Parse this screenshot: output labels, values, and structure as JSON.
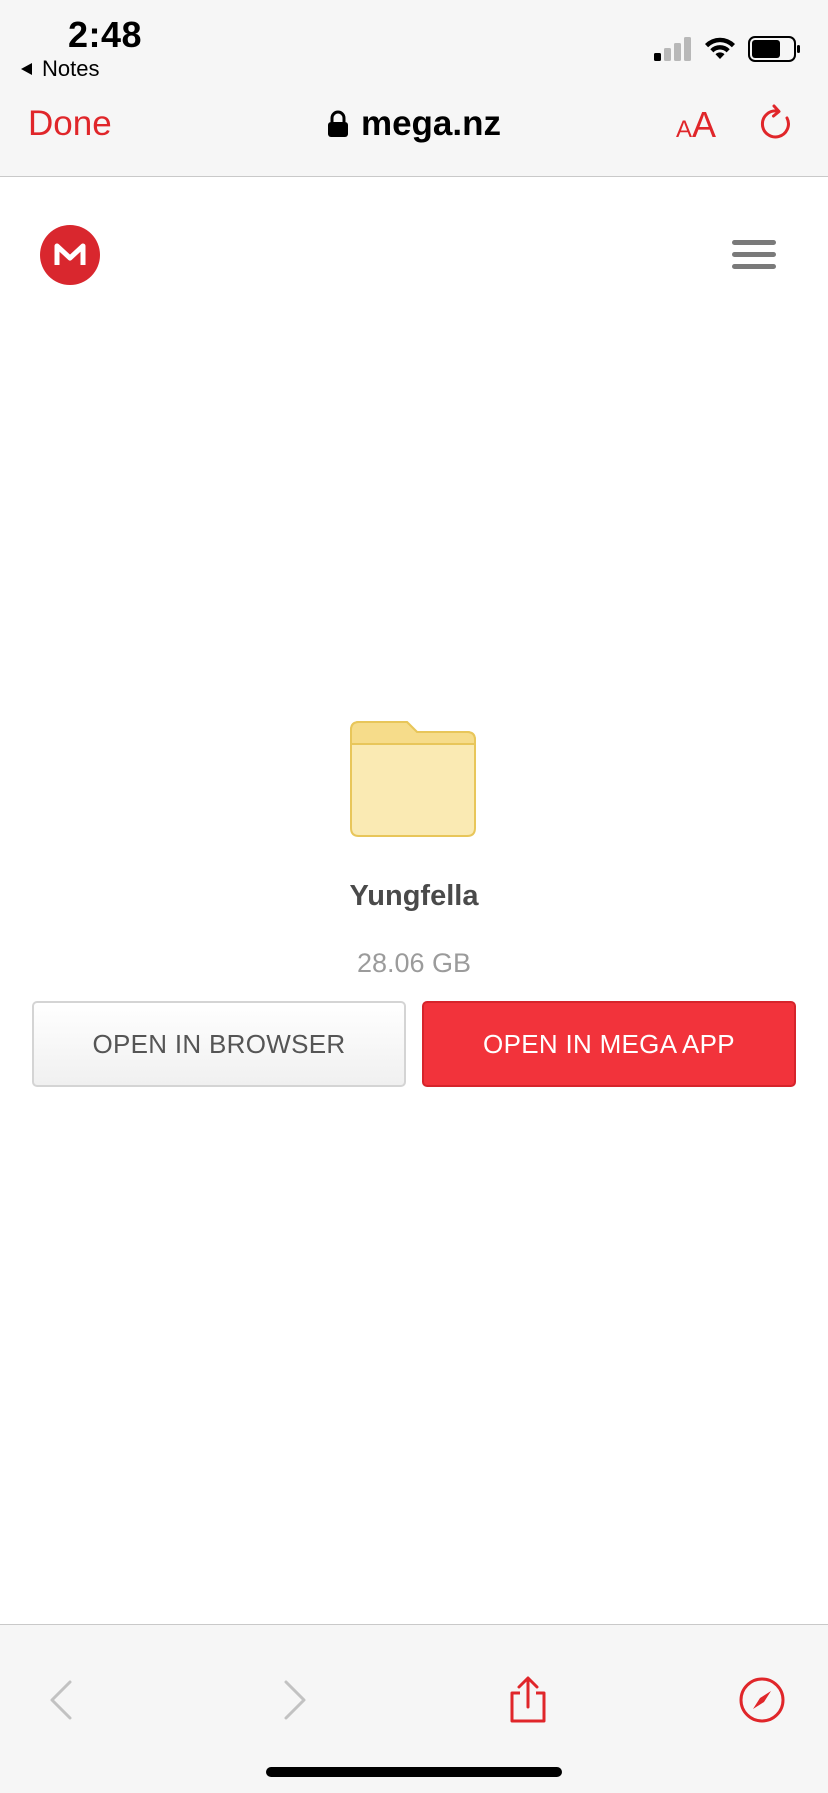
{
  "status_bar": {
    "time": "2:48",
    "back_app_label": "Notes"
  },
  "safari_nav": {
    "done_label": "Done",
    "url": "mega.nz",
    "text_size_small": "A",
    "text_size_big": "A"
  },
  "page": {
    "folder_name": "Yungfella",
    "folder_size": "28.06 GB",
    "open_browser_label": "OPEN IN BROWSER",
    "open_app_label": "OPEN IN MEGA APP"
  },
  "icons": {
    "logo": "mega-logo-icon",
    "menu": "hamburger-menu-icon",
    "folder": "folder-icon",
    "back": "chevron-left-icon",
    "forward": "chevron-right-icon",
    "share": "share-icon",
    "compass": "compass-icon",
    "lock": "lock-icon",
    "reload": "reload-icon"
  },
  "colors": {
    "accent": "#e0262a",
    "mega_red": "#d9272e",
    "app_button": "#f2333b",
    "folder_fill": "#faeab3",
    "folder_stroke": "#e8c65a"
  }
}
